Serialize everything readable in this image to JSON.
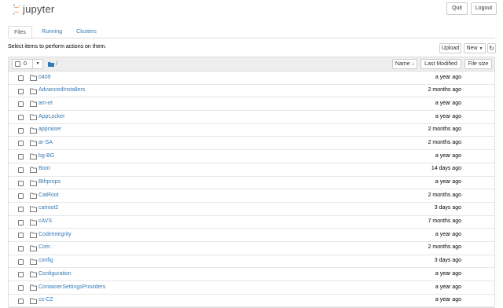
{
  "header": {
    "logo_text": "jupyter",
    "quit_label": "Quit",
    "logout_label": "Logout"
  },
  "tabs": [
    {
      "label": "Files"
    },
    {
      "label": "Running"
    },
    {
      "label": "Clusters"
    }
  ],
  "toolbar": {
    "info_text": "Select items to perform actions on them.",
    "upload_label": "Upload",
    "new_label": "New",
    "refresh_icon": "refresh-icon"
  },
  "list_header": {
    "selected_count": "0",
    "breadcrumb_path": "/",
    "name_label": "Name",
    "last_modified_label": "Last Modified",
    "file_size_label": "File size"
  },
  "items": [
    {
      "name": "0409",
      "modified": "a year ago"
    },
    {
      "name": "AdvancedInstallers",
      "modified": "2 months ago"
    },
    {
      "name": "am-et",
      "modified": "a year ago"
    },
    {
      "name": "AppLocker",
      "modified": "a year ago"
    },
    {
      "name": "appraiser",
      "modified": "2 months ago"
    },
    {
      "name": "ar-SA",
      "modified": "2 months ago"
    },
    {
      "name": "bg-BG",
      "modified": "a year ago"
    },
    {
      "name": "Boot",
      "modified": "14 days ago"
    },
    {
      "name": "Bthprops",
      "modified": "a year ago"
    },
    {
      "name": "CatRoot",
      "modified": "2 months ago"
    },
    {
      "name": "catroot2",
      "modified": "3 days ago"
    },
    {
      "name": "cAVS",
      "modified": "7 months ago"
    },
    {
      "name": "CodeIntegrity",
      "modified": "a year ago"
    },
    {
      "name": "Com",
      "modified": "2 months ago"
    },
    {
      "name": "config",
      "modified": "3 days ago"
    },
    {
      "name": "Configuration",
      "modified": "a year ago"
    },
    {
      "name": "ContainerSettingsProviders",
      "modified": "a year ago"
    },
    {
      "name": "cs-CZ",
      "modified": "a year ago"
    }
  ],
  "colors": {
    "link": "#337ab7",
    "logo_orange": "#f37726",
    "header_bg": "#eeeeee"
  }
}
